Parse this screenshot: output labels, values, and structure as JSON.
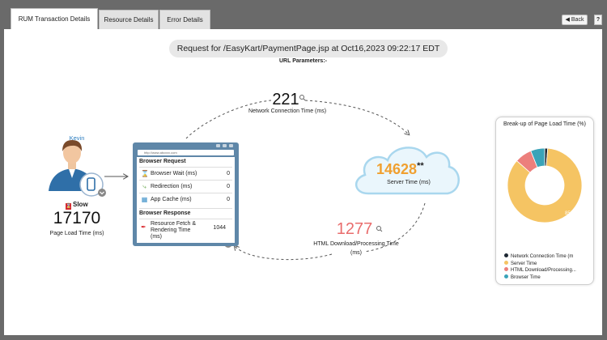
{
  "tabs": [
    {
      "label": "RUM Transaction Details",
      "active": true
    },
    {
      "label": "Resource Details",
      "active": false
    },
    {
      "label": "Error Details",
      "active": false
    }
  ],
  "toolbar": {
    "back_label": "Back",
    "help_label": "?"
  },
  "request": {
    "title": "Request for /EasyKart/PaymentPage.jsp at Oct16,2023 09:22:17 EDT",
    "url_params_label": "URL Parameters:-"
  },
  "user": {
    "name": "Kevin",
    "status": "Slow",
    "page_load_value": "17170",
    "page_load_label": "Page Load Time (ms)"
  },
  "browser": {
    "address": "http://www.abcxxx.com",
    "request_header": "Browser Request",
    "request_rows": [
      {
        "label": "Browser Wait (ms)",
        "value": "0"
      },
      {
        "label": "Redirection (ms)",
        "value": "0"
      },
      {
        "label": "App Cache (ms)",
        "value": "0"
      }
    ],
    "response_header": "Browser Response",
    "fetch_label": "Resource Fetch & Rendering Time (ms)",
    "fetch_value": "1044"
  },
  "network": {
    "value": "221",
    "label": "Network Connection Time (ms)"
  },
  "server": {
    "value": "14628",
    "suffix": "**",
    "label": "Server Time (ms)"
  },
  "html": {
    "value": "1277",
    "label": "HTML Download/Processing Time (ms)"
  },
  "breakup": {
    "title": "Break-up of Page Load Time (%)",
    "center_label": "85 %",
    "legend": [
      {
        "label": "Network Connection Time (m",
        "color": "#1d2733"
      },
      {
        "label": "Server Time",
        "color": "#f5c463"
      },
      {
        "label": "HTML Download/Processing...",
        "color": "#ec7f7c"
      },
      {
        "label": "Browser Time",
        "color": "#3aa3b8"
      }
    ]
  },
  "chart_data": {
    "type": "pie",
    "title": "Break-up of Page Load Time (%)",
    "categories": [
      "Network Connection Time (ms)",
      "Server Time",
      "HTML Download/Processing Time",
      "Browser Time"
    ],
    "values": [
      1.3,
      85.2,
      7.4,
      6.1
    ],
    "colors": [
      "#1d2733",
      "#f5c463",
      "#ec7f7c",
      "#3aa3b8"
    ],
    "legend": "bottom"
  }
}
